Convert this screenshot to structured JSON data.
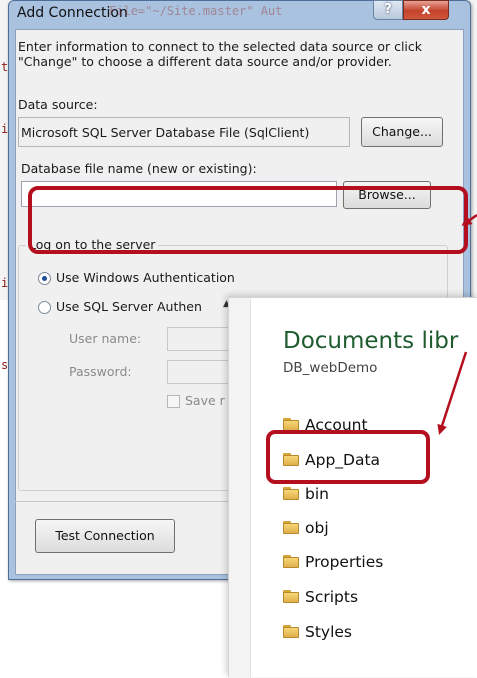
{
  "background_code": {
    "line1": "t",
    "line2": "i",
    "line3": "i",
    "line4": "s"
  },
  "dialog": {
    "title": "Add Connection",
    "title_overlay_code": "File=\"~/Site.master\" Aut",
    "help_label": "?",
    "close_label": "x",
    "intro": "Enter information to connect to the selected data source or click \"Change\" to choose a different data source and/or provider.",
    "data_source_label": "Data source:",
    "data_source_value": "Microsoft SQL Server Database File (SqlClient)",
    "change_button": "Change...",
    "db_file_label": "Database file name (new or existing):",
    "db_file_value": "",
    "browse_button": "Browse...",
    "logon_group_label": "Log on to the server",
    "auth_options": [
      {
        "label": "Use Windows Authentication",
        "selected": true
      },
      {
        "label": "Use SQL Server Authen",
        "selected": false
      }
    ],
    "user_name_label": "User name:",
    "password_label": "Password:",
    "save_label": "Save r",
    "test_button": "Test Connection"
  },
  "explorer": {
    "heading": "Documents libr",
    "subheading": "DB_webDemo",
    "folders": [
      {
        "name": "Account"
      },
      {
        "name": "App_Data"
      },
      {
        "name": "bin"
      },
      {
        "name": "obj"
      },
      {
        "name": "Properties"
      },
      {
        "name": "Scripts"
      },
      {
        "name": "Styles"
      }
    ]
  },
  "colors": {
    "highlight": "#b40f1e",
    "heading_green": "#1e5b2e",
    "dialog_frame": "#a9c2df"
  }
}
